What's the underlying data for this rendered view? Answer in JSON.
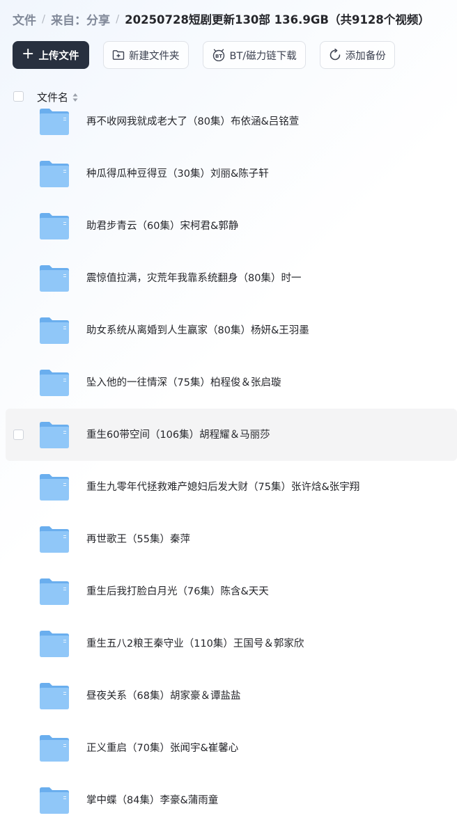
{
  "breadcrumb": {
    "root": "文件",
    "level1": "来自：分享",
    "current": "20250728短剧更新130部 136.9GB（共9128个视频）"
  },
  "toolbar": {
    "upload": "上传文件",
    "new_folder": "新建文件夹",
    "bt": "BT/磁力链下载",
    "backup": "添加备份"
  },
  "list_header": {
    "name_column": "文件名"
  },
  "files": [
    {
      "name": "再不收网我就成老大了（80集）布依涵&吕铭萱"
    },
    {
      "name": "种瓜得瓜种豆得豆（30集）刘丽&陈子轩"
    },
    {
      "name": "助君步青云（60集）宋柯君&郭静"
    },
    {
      "name": "震惊值拉满，灾荒年我靠系统翻身（80集）时一"
    },
    {
      "name": "助女系统从离婚到人生赢家（80集）杨妍&王羽墨"
    },
    {
      "name": "坠入他的一往情深（75集）柏程俊＆张启璇"
    },
    {
      "name": "重生60带空间（106集）胡程耀＆马丽莎"
    },
    {
      "name": "重生九零年代拯救难产媳妇后发大财（75集）张许焓&张宇翔"
    },
    {
      "name": "再世歌王（55集）秦萍"
    },
    {
      "name": "重生后我打脸白月光（76集）陈含&天天"
    },
    {
      "name": "重生五八2粮王秦守业（110集）王国号＆郭家欣"
    },
    {
      "name": "昼夜关系（68集）胡家豪＆谭盐盐"
    },
    {
      "name": "正义重启（70集）张闻宇&崔馨心"
    },
    {
      "name": "掌中蝶（84集）李豪&蒲雨童"
    }
  ],
  "hovered_index": 6,
  "icons": {
    "upload": "plus-icon",
    "new_folder": "folder-plus-icon",
    "bt": "bt-icon",
    "backup": "sync-icon",
    "sort": "sort-icon",
    "file": "folder-icon"
  },
  "colors": {
    "primary": "#28303f",
    "folder": "#6aaeee",
    "hover_row": "#f4f4f5"
  }
}
